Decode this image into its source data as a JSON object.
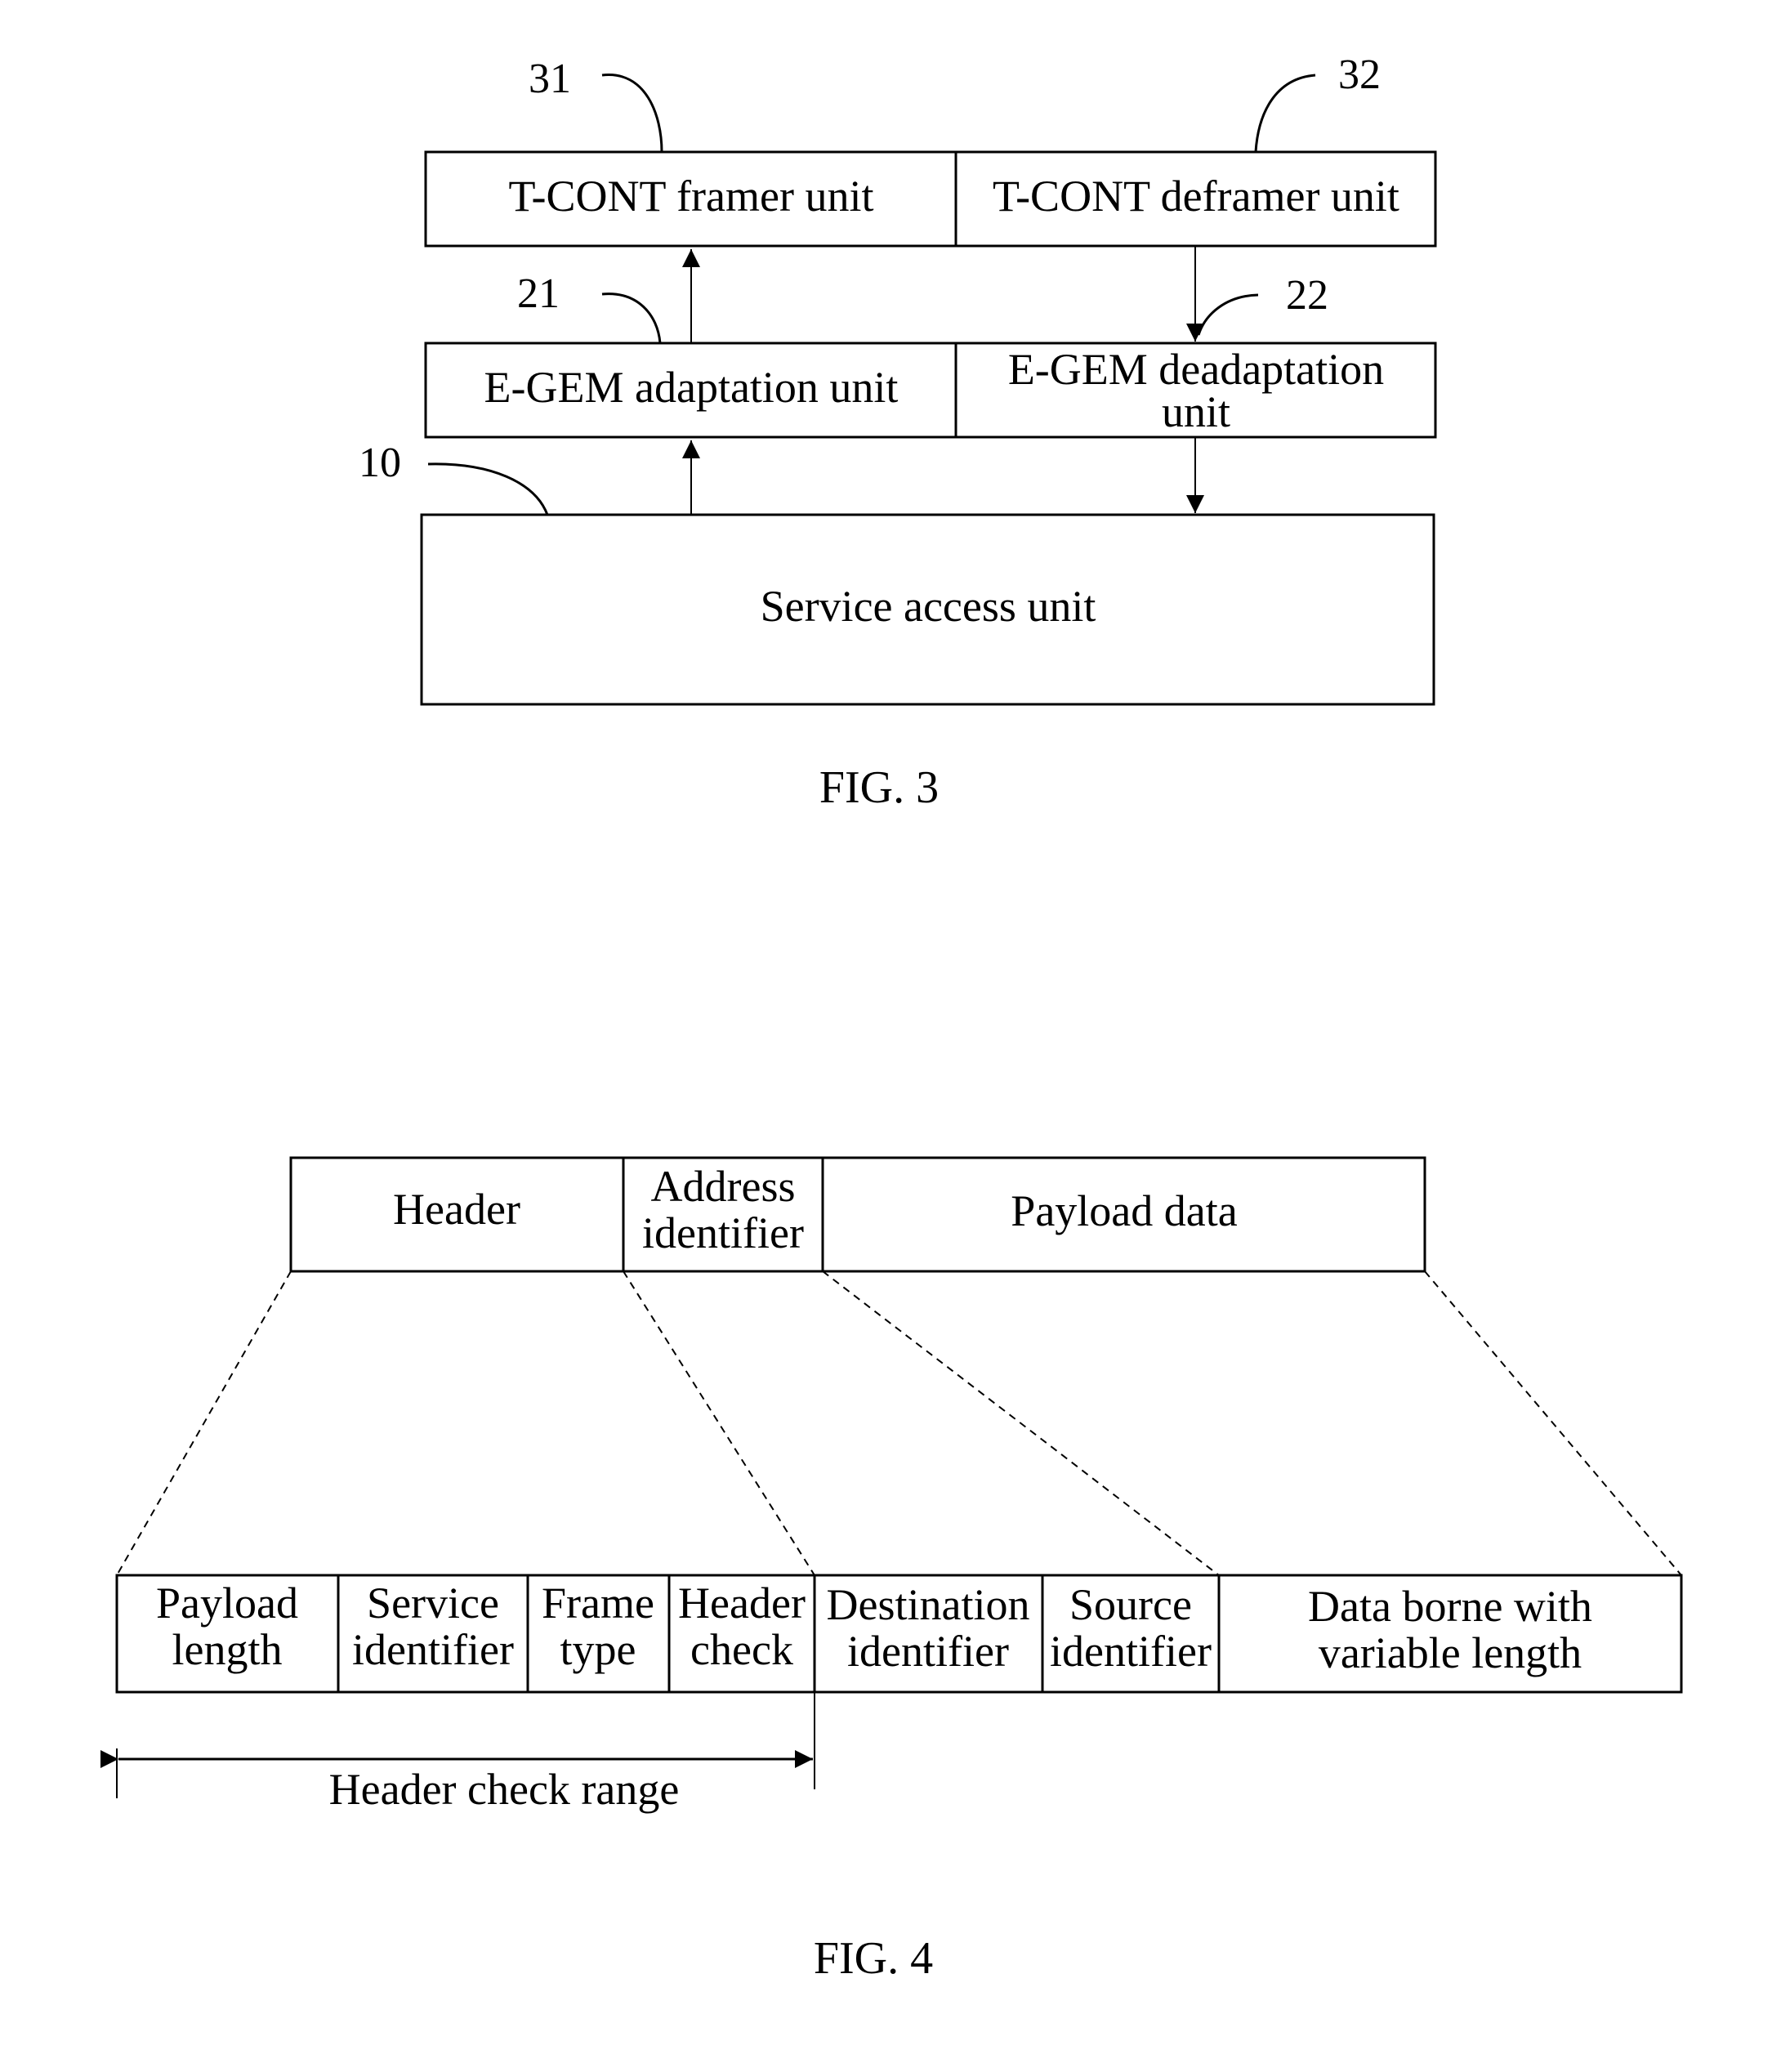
{
  "fig3": {
    "caption": "FIG. 3",
    "boxes": {
      "tcont_framer": "T-CONT framer unit",
      "tcont_deframer": "T-CONT deframer unit",
      "egem_adaptation": "E-GEM adaptation unit",
      "egem_deadaptation_line1": "E-GEM deadaptation",
      "egem_deadaptation_line2": "unit",
      "service_access": "Service access unit"
    },
    "refs": {
      "r31": "31",
      "r32": "32",
      "r21": "21",
      "r22": "22",
      "r10": "10"
    }
  },
  "fig4": {
    "caption": "FIG. 4",
    "top_row": {
      "header": "Header",
      "address_line1": "Address",
      "address_line2": "identifier",
      "payload": "Payload data"
    },
    "bottom_row": [
      {
        "l1": "Payload",
        "l2": "length"
      },
      {
        "l1": "Service",
        "l2": "identifier"
      },
      {
        "l1": "Frame",
        "l2": "type"
      },
      {
        "l1": "Header",
        "l2": "check"
      },
      {
        "l1": "Destination",
        "l2": "identifier"
      },
      {
        "l1": "Source",
        "l2": "identifier"
      },
      {
        "l1": "Data borne with",
        "l2": "variable length"
      }
    ],
    "range_label": "Header check range"
  }
}
